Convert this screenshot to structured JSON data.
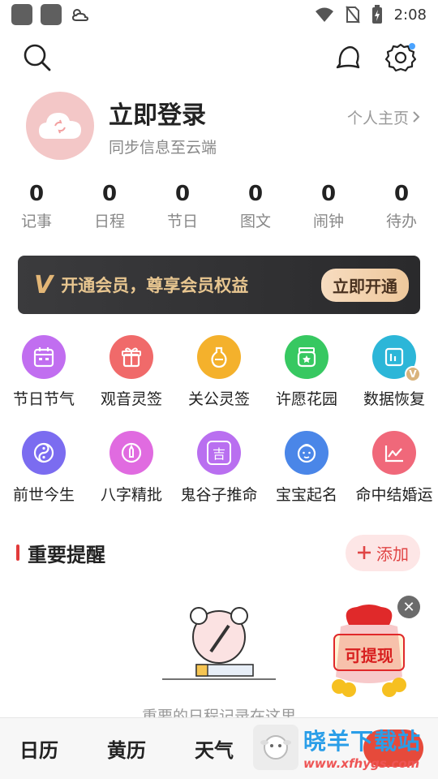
{
  "status": {
    "time": "2:08"
  },
  "profile": {
    "title": "立即登录",
    "subtitle": "同步信息至云端",
    "homepage": "个人主页"
  },
  "stats": [
    {
      "num": "0",
      "label": "记事"
    },
    {
      "num": "0",
      "label": "日程"
    },
    {
      "num": "0",
      "label": "节日"
    },
    {
      "num": "0",
      "label": "图文"
    },
    {
      "num": "0",
      "label": "闹钟"
    },
    {
      "num": "0",
      "label": "待办"
    }
  ],
  "vip": {
    "mark": "V",
    "text": "开通会员，尊享会员权益",
    "button": "立即开通"
  },
  "features": [
    {
      "label": "节日节气",
      "icon": "calendar-icon",
      "color": "#c16ef0"
    },
    {
      "label": "观音灵签",
      "icon": "gift-icon",
      "color": "#f06a6a"
    },
    {
      "label": "关公灵签",
      "icon": "gourd-icon",
      "color": "#f4b12c"
    },
    {
      "label": "许愿花园",
      "icon": "jar-icon",
      "color": "#37c861"
    },
    {
      "label": "数据恢复",
      "icon": "data-restore-icon",
      "color": "#2cb6d8",
      "badge": "V"
    },
    {
      "label": "前世今生",
      "icon": "yin-yang-icon",
      "color": "#7b6cf0"
    },
    {
      "label": "八字精批",
      "icon": "pen-icon",
      "color": "#e06be0"
    },
    {
      "label": "鬼谷子推命",
      "icon": "lucky-icon",
      "color": "#b96ff0",
      "glyph": "吉"
    },
    {
      "label": "宝宝起名",
      "icon": "baby-icon",
      "color": "#4a86e8"
    },
    {
      "label": "命中结婚运",
      "icon": "chart-line-icon",
      "color": "#f0687a"
    }
  ],
  "reminder": {
    "title": "重要提醒",
    "add": "添加",
    "empty_text": "重要的日程记录在这里"
  },
  "float_ad": {
    "text": "可提现",
    "close": "✕"
  },
  "bottom_nav": [
    "日历",
    "黄历",
    "天气"
  ],
  "watermark": {
    "title": "晓羊下载站",
    "url": "www.xfhygs.com"
  },
  "colors": {
    "accent": "#e23b3b",
    "vip_gold": "#e8c690"
  }
}
